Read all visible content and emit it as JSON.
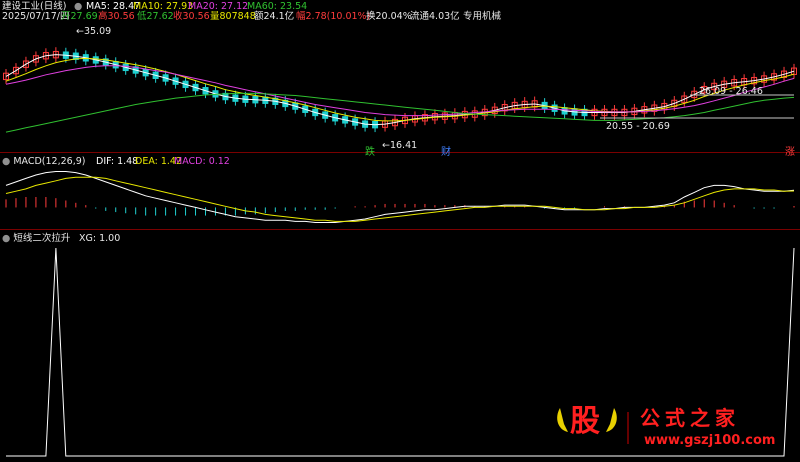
{
  "header": {
    "title": "建设工业(日线)",
    "ma5": "MA5: 28.47",
    "ma10": "MA10: 27.93",
    "ma20": "MA20: 27.12",
    "ma60": "MA60: 23.54",
    "row2": {
      "date": "2025/07/17/四",
      "open": "开27.69",
      "high": "高30.56",
      "low": "低27.62",
      "close": "收30.56",
      "vol": "量807848",
      "amount": "额24.1亿",
      "change": "幅2.78(10.01%)",
      "turnover": "换20.04%",
      "float": "流通4.03亿",
      "sector": "专用机械"
    }
  },
  "colors": {
    "up": "#ff3c3c",
    "down": "#20d0d0",
    "ma5": "#ffffff",
    "ma10": "#e8e800",
    "ma20": "#e040e0",
    "ma60": "#30c030",
    "macd_dif": "#ffffff",
    "macd_dea": "#e8e800",
    "macd_val": "#e040e0"
  },
  "annotations": {
    "peak": "35.09",
    "trough": "16.41",
    "range_right": "26.09 - 26.46",
    "range_mid": "20.55 - 20.69",
    "label_die": "跌",
    "label_cai": "财",
    "label_zhang": "涨"
  },
  "macd_panel": {
    "title": "MACD(12,26,9)",
    "dif": "DIF: 1.48",
    "dea": "DEA: 1.42",
    "macd": "MACD: 0.12"
  },
  "xg_panel": {
    "title": "短线二次拉升",
    "xg": "XG: 1.00"
  },
  "watermark": {
    "logo_char": "股",
    "name": "公式之家",
    "url": "www.gszj100.com"
  },
  "chart_data": [
    {
      "type": "line",
      "name": "price-ma",
      "series": [
        {
          "name": "MA5",
          "values": [
            27.5,
            28.6,
            29.8,
            30.8,
            31.4,
            31.6,
            31.5,
            31.3,
            31.0,
            30.6,
            30.2,
            29.7,
            29.2,
            28.7,
            28.2,
            27.7,
            27.2,
            26.6,
            26.0,
            25.4,
            24.8,
            24.2,
            23.7,
            23.4,
            23.2,
            23.1,
            23.0,
            22.8,
            22.4,
            21.9,
            21.3,
            20.7,
            20.2,
            19.7,
            19.3,
            18.9,
            18.5,
            18.4,
            18.5,
            18.8,
            19.2,
            19.5,
            19.7,
            19.9,
            20.0,
            20.1,
            20.3,
            20.4,
            20.7,
            21.1,
            21.6,
            22.0,
            22.2,
            22.3,
            22.0,
            21.5,
            21.0,
            20.8,
            20.7,
            20.7,
            20.7,
            20.7,
            20.7,
            20.9,
            21.2,
            21.5,
            21.8,
            22.4,
            23.2,
            24.1,
            25.0,
            25.6,
            26.0,
            26.3,
            26.5,
            26.7,
            27.0,
            27.4,
            27.9,
            28.47
          ]
        },
        {
          "name": "MA10",
          "values": [
            26.6,
            27.3,
            28.0,
            28.8,
            29.5,
            30.1,
            30.5,
            30.8,
            30.9,
            30.8,
            30.6,
            30.3,
            30.0,
            29.7,
            29.3,
            28.9,
            28.4,
            27.9,
            27.3,
            26.7,
            26.1,
            25.6,
            25.0,
            24.6,
            24.2,
            23.9,
            23.6,
            23.3,
            22.9,
            22.5,
            22.1,
            21.6,
            21.1,
            20.6,
            20.2,
            19.8,
            19.5,
            19.2,
            19.1,
            19.1,
            19.2,
            19.4,
            19.6,
            19.8,
            19.9,
            20.0,
            20.2,
            20.4,
            20.6,
            20.8,
            21.1,
            21.4,
            21.6,
            21.8,
            21.9,
            21.8,
            21.6,
            21.4,
            21.2,
            21.0,
            20.9,
            20.8,
            20.8,
            20.8,
            21.0,
            21.2,
            21.5,
            21.9,
            22.4,
            23.0,
            23.7,
            24.3,
            24.9,
            25.4,
            25.9,
            26.3,
            26.7,
            27.0,
            27.4,
            27.93
          ]
        },
        {
          "name": "MA20",
          "values": [
            26.0,
            26.4,
            26.8,
            27.3,
            27.8,
            28.2,
            28.6,
            28.9,
            29.2,
            29.4,
            29.5,
            29.5,
            29.4,
            29.2,
            28.9,
            28.6,
            28.3,
            27.9,
            27.5,
            27.1,
            26.7,
            26.3,
            25.8,
            25.4,
            25.0,
            24.6,
            24.2,
            23.8,
            23.4,
            23.0,
            22.6,
            22.2,
            21.9,
            21.6,
            21.3,
            21.0,
            20.7,
            20.5,
            20.3,
            20.2,
            20.1,
            20.1,
            20.1,
            20.2,
            20.3,
            20.4,
            20.5,
            20.7,
            20.8,
            21.0,
            21.1,
            21.2,
            21.3,
            21.3,
            21.3,
            21.3,
            21.2,
            21.1,
            21.0,
            20.9,
            20.8,
            20.8,
            20.8,
            20.8,
            20.9,
            21.0,
            21.2,
            21.4,
            21.7,
            22.0,
            22.4,
            22.9,
            23.4,
            23.9,
            24.5,
            25.0,
            25.5,
            26.0,
            26.6,
            27.12
          ]
        },
        {
          "name": "MA60",
          "values": [
            17.0,
            17.4,
            17.8,
            18.2,
            18.6,
            19.0,
            19.4,
            19.8,
            20.2,
            20.6,
            21.0,
            21.4,
            21.8,
            22.2,
            22.5,
            22.8,
            23.1,
            23.4,
            23.6,
            23.8,
            24.0,
            24.1,
            24.2,
            24.3,
            24.3,
            24.3,
            24.2,
            24.1,
            24.0,
            23.9,
            23.7,
            23.5,
            23.3,
            23.1,
            22.9,
            22.7,
            22.5,
            22.3,
            22.1,
            21.9,
            21.7,
            21.5,
            21.3,
            21.1,
            20.9,
            20.7,
            20.5,
            20.4,
            20.3,
            20.2,
            20.1,
            20.0,
            19.9,
            19.8,
            19.7,
            19.6,
            19.5,
            19.4,
            19.3,
            19.2,
            19.2,
            19.2,
            19.3,
            19.4,
            19.5,
            19.6,
            19.7,
            19.9,
            20.1,
            20.4,
            20.7,
            21.1,
            21.5,
            21.9,
            22.3,
            22.7,
            23.0,
            23.2,
            23.4,
            23.54
          ]
        }
      ],
      "ylim": [
        14,
        37
      ]
    },
    {
      "type": "line",
      "name": "macd",
      "series": [
        {
          "name": "DIF",
          "values": [
            1.9,
            2.2,
            2.5,
            2.8,
            3.0,
            3.1,
            3.1,
            3.0,
            2.8,
            2.5,
            2.2,
            1.9,
            1.6,
            1.3,
            1.0,
            0.8,
            0.6,
            0.4,
            0.2,
            0.0,
            -0.2,
            -0.4,
            -0.6,
            -0.8,
            -0.9,
            -1.0,
            -1.1,
            -1.1,
            -1.1,
            -1.2,
            -1.2,
            -1.3,
            -1.3,
            -1.3,
            -1.2,
            -1.1,
            -1.0,
            -0.8,
            -0.6,
            -0.5,
            -0.4,
            -0.3,
            -0.2,
            -0.2,
            -0.1,
            0.0,
            0.1,
            0.1,
            0.1,
            0.1,
            0.2,
            0.2,
            0.2,
            0.1,
            0.0,
            -0.1,
            -0.2,
            -0.2,
            -0.2,
            -0.2,
            -0.1,
            -0.1,
            0.0,
            0.0,
            0.0,
            0.1,
            0.2,
            0.4,
            0.9,
            1.3,
            1.7,
            1.9,
            1.9,
            1.8,
            1.6,
            1.5,
            1.4,
            1.4,
            1.4,
            1.48
          ]
        },
        {
          "name": "DEA",
          "values": [
            1.2,
            1.4,
            1.6,
            1.9,
            2.1,
            2.3,
            2.5,
            2.6,
            2.6,
            2.6,
            2.5,
            2.3,
            2.1,
            1.9,
            1.7,
            1.5,
            1.3,
            1.1,
            0.9,
            0.7,
            0.5,
            0.3,
            0.1,
            -0.1,
            -0.3,
            -0.4,
            -0.6,
            -0.7,
            -0.8,
            -0.9,
            -1.0,
            -1.1,
            -1.1,
            -1.2,
            -1.2,
            -1.2,
            -1.1,
            -1.0,
            -0.9,
            -0.8,
            -0.7,
            -0.6,
            -0.5,
            -0.4,
            -0.3,
            -0.2,
            -0.1,
            0.0,
            0.0,
            0.1,
            0.1,
            0.1,
            0.1,
            0.1,
            0.1,
            0.0,
            -0.1,
            -0.1,
            -0.2,
            -0.2,
            -0.2,
            -0.1,
            -0.1,
            0.0,
            0.0,
            0.0,
            0.1,
            0.2,
            0.4,
            0.7,
            1.0,
            1.3,
            1.5,
            1.6,
            1.6,
            1.6,
            1.5,
            1.5,
            1.4,
            1.42
          ]
        }
      ],
      "histogram": [
        0.7,
        0.8,
        0.9,
        0.9,
        0.9,
        0.8,
        0.6,
        0.4,
        0.2,
        -0.1,
        -0.3,
        -0.4,
        -0.5,
        -0.6,
        -0.7,
        -0.7,
        -0.7,
        -0.7,
        -0.7,
        -0.7,
        -0.7,
        -0.7,
        -0.7,
        -0.7,
        -0.6,
        -0.6,
        -0.5,
        -0.4,
        -0.3,
        -0.3,
        -0.2,
        -0.2,
        -0.2,
        -0.1,
        0.0,
        0.1,
        0.1,
        0.2,
        0.3,
        0.3,
        0.3,
        0.3,
        0.3,
        0.2,
        0.2,
        0.2,
        0.2,
        0.1,
        0.1,
        0.0,
        0.1,
        0.1,
        0.1,
        0.0,
        -0.1,
        -0.1,
        -0.1,
        -0.1,
        0.0,
        0.0,
        0.1,
        0.0,
        0.1,
        0.0,
        0.0,
        0.1,
        0.1,
        0.2,
        0.5,
        0.6,
        0.7,
        0.6,
        0.4,
        0.2,
        0.0,
        -0.1,
        -0.1,
        -0.1,
        0.0,
        0.12
      ],
      "ylim": [
        -1.6,
        3.4
      ]
    },
    {
      "type": "line",
      "name": "xg",
      "series": [
        {
          "name": "XG",
          "values": [
            0,
            0,
            0,
            0,
            0,
            1,
            0,
            0,
            0,
            0,
            0,
            0,
            0,
            0,
            0,
            0,
            0,
            0,
            0,
            0,
            0,
            0,
            0,
            0,
            0,
            0,
            0,
            0,
            0,
            0,
            0,
            0,
            0,
            0,
            0,
            0,
            0,
            0,
            0,
            0,
            0,
            0,
            0,
            0,
            0,
            0,
            0,
            0,
            0,
            0,
            0,
            0,
            0,
            0,
            0,
            0,
            0,
            0,
            0,
            0,
            0,
            0,
            0,
            0,
            0,
            0,
            0,
            0,
            0,
            0,
            0,
            0,
            0,
            0,
            0,
            0,
            0,
            0,
            0,
            1
          ]
        }
      ],
      "ylim": [
        0,
        1
      ]
    }
  ]
}
